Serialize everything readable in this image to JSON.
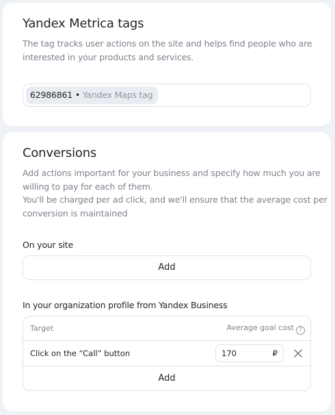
{
  "metrica": {
    "title": "Yandex Metrica tags",
    "description_lines": [
      "The tag tracks user actions on the site and helps find people who are",
      "interested in your products and services."
    ],
    "tag": {
      "number": "62986861",
      "separator": "•",
      "name": "Yandex Maps tag"
    }
  },
  "conversions": {
    "title": "Conversions",
    "description_lines": [
      "Add actions important for your business and specify how much you are",
      "willing to pay for each of them.",
      "You'll be charged per ad click, and we'll ensure that the average cost per",
      "conversion is maintained"
    ],
    "site": {
      "label": "On your site",
      "add_label": "Add"
    },
    "business": {
      "label": "In your organization profile from Yandex Business",
      "col_target": "Target",
      "col_cost": "Average goal cost",
      "help_icon": "question-circle-icon",
      "rows": [
        {
          "target": "Click on the “Call” button",
          "cost": "170",
          "currency": "₽"
        }
      ],
      "add_label": "Add"
    }
  },
  "colors": {
    "page_bg": "#eef1f5",
    "card_bg": "#ffffff",
    "text_primary": "#21242b",
    "text_secondary": "#7d828c",
    "border": "#dde1e6",
    "chip_bg": "#e9ecf1"
  }
}
